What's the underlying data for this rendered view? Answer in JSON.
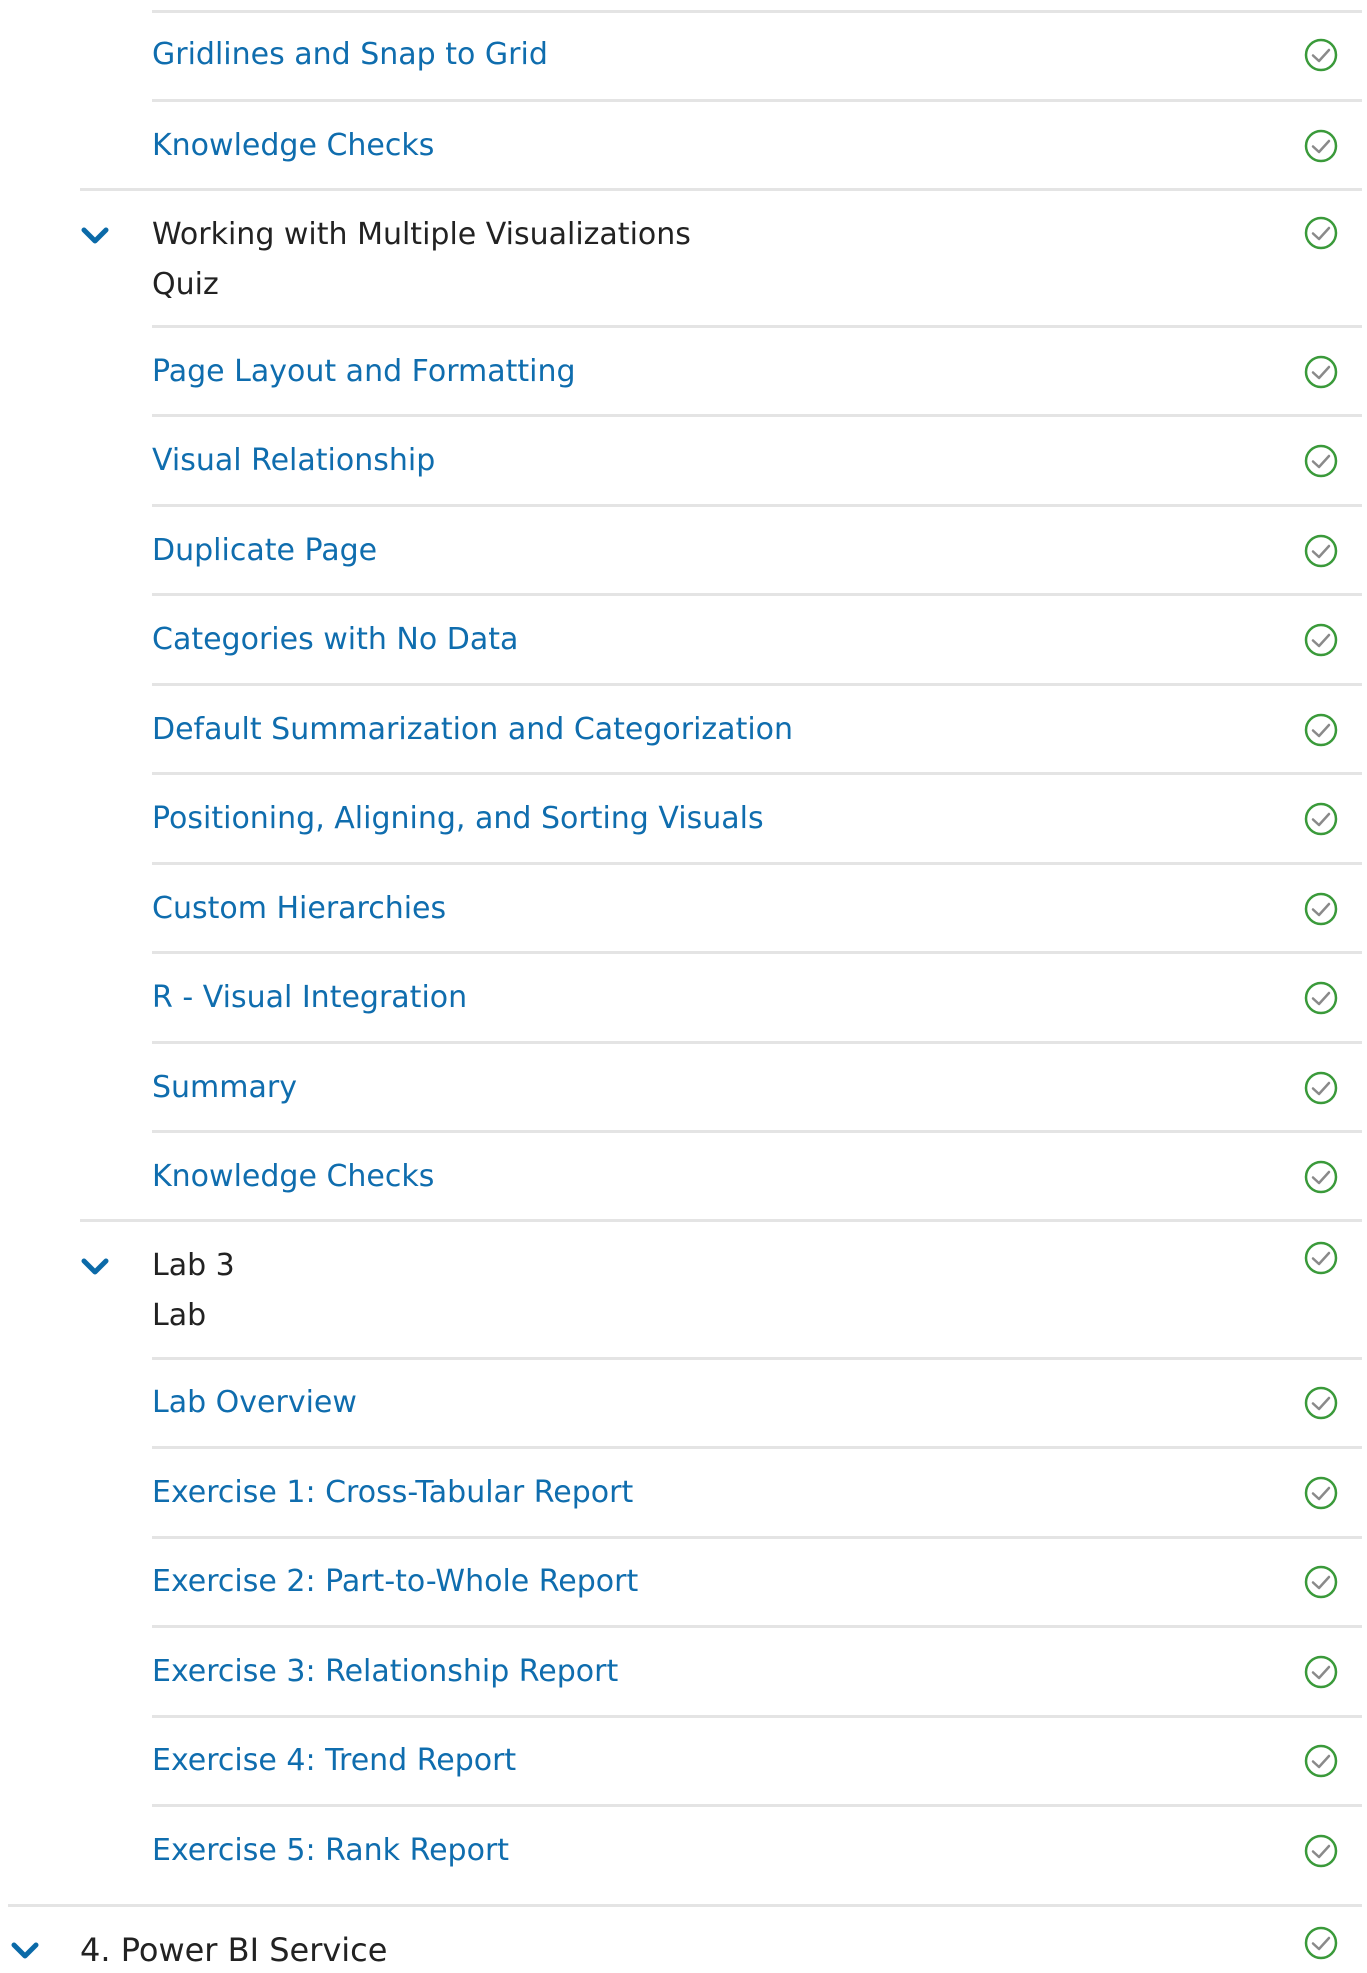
{
  "top_items": [
    {
      "label": "Gridlines and Snap to Grid",
      "status_icon": "check-circle-icon"
    },
    {
      "label": "Knowledge Checks",
      "status_icon": "check-circle-icon"
    }
  ],
  "module_multiple_viz": {
    "title": "Working with Multiple Visualizations",
    "type": "Quiz",
    "expand_icon": "chevron-down-icon",
    "items": [
      {
        "label": "Page Layout and Formatting"
      },
      {
        "label": "Visual Relationship"
      },
      {
        "label": "Duplicate Page"
      },
      {
        "label": "Categories with No Data"
      },
      {
        "label": "Default Summarization and Categorization"
      },
      {
        "label": "Positioning, Aligning, and Sorting Visuals"
      },
      {
        "label": "Custom Hierarchies"
      },
      {
        "label": "R - Visual Integration"
      },
      {
        "label": "Summary"
      },
      {
        "label": "Knowledge Checks"
      }
    ]
  },
  "module_lab3": {
    "title": "Lab 3",
    "type": "Lab",
    "expand_icon": "chevron-down-icon",
    "items": [
      {
        "label": "Lab Overview"
      },
      {
        "label": "Exercise 1: Cross-Tabular Report"
      },
      {
        "label": "Exercise 2: Part-to-Whole Report"
      },
      {
        "label": "Exercise 3: Relationship Report"
      },
      {
        "label": "Exercise 4: Trend Report"
      },
      {
        "label": "Exercise 5: Rank Report"
      }
    ]
  },
  "section_next": {
    "title": "4. Power BI Service",
    "expand_icon": "chevron-down-icon"
  },
  "colors": {
    "link": "#0f6dae",
    "chevron": "#0b6aa8",
    "check": "#3a9a3a",
    "divider": "#e4e4e4",
    "text": "#222222"
  }
}
